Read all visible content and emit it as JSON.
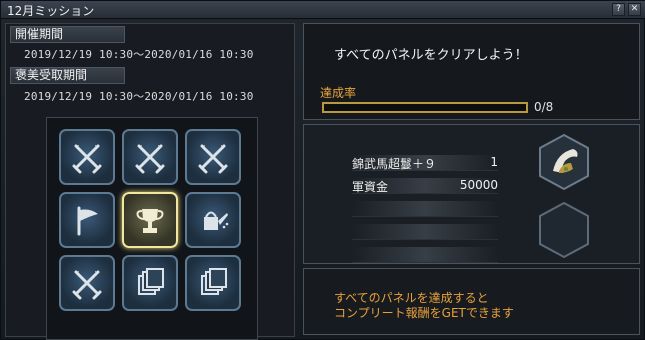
{
  "window": {
    "title": "12月ミッション",
    "help_label": "?",
    "close_label": "✕"
  },
  "schedule": {
    "event_label": "開催期間",
    "event_period": "2019/12/19 10:30～2020/01/16 10:30",
    "reward_label": "褒美受取期間",
    "reward_period": "2019/12/19 10:30～2020/01/16 10:30"
  },
  "panels": [
    {
      "icon": "crossed-swords-icon",
      "active": false
    },
    {
      "icon": "crossed-swords-icon",
      "active": false
    },
    {
      "icon": "crossed-swords-icon",
      "active": false
    },
    {
      "icon": "flag-icon",
      "active": false
    },
    {
      "icon": "trophy-icon",
      "active": true
    },
    {
      "icon": "watering-can-icon",
      "active": false
    },
    {
      "icon": "crossed-swords-icon",
      "active": false
    },
    {
      "icon": "stacked-cards-icon",
      "active": false
    },
    {
      "icon": "stacked-cards-icon",
      "active": false
    }
  ],
  "mission": {
    "text": "すべてのパネルをクリアしよう！",
    "rate_label": "達成率",
    "progress_text": "0/8",
    "progress_fraction": 0.0
  },
  "rewards": {
    "items": [
      {
        "name": "錦武馬超鬘＋９",
        "qty": "1"
      },
      {
        "name": "軍資金",
        "qty": "50000"
      },
      {
        "name": "",
        "qty": ""
      },
      {
        "name": "",
        "qty": ""
      },
      {
        "name": "",
        "qty": ""
      }
    ],
    "slot_icons": [
      "feather-helmet-icon",
      "empty-slot-icon"
    ]
  },
  "notice": {
    "line1": "すべてのパネルを達成すると",
    "line2": "コンプリート報酬をGETできます"
  },
  "colors": {
    "accent_orange": "#e8a03a",
    "gold": "#d9b94a",
    "tile_border": "#5c7a92",
    "active_border": "#f3e7a0"
  }
}
